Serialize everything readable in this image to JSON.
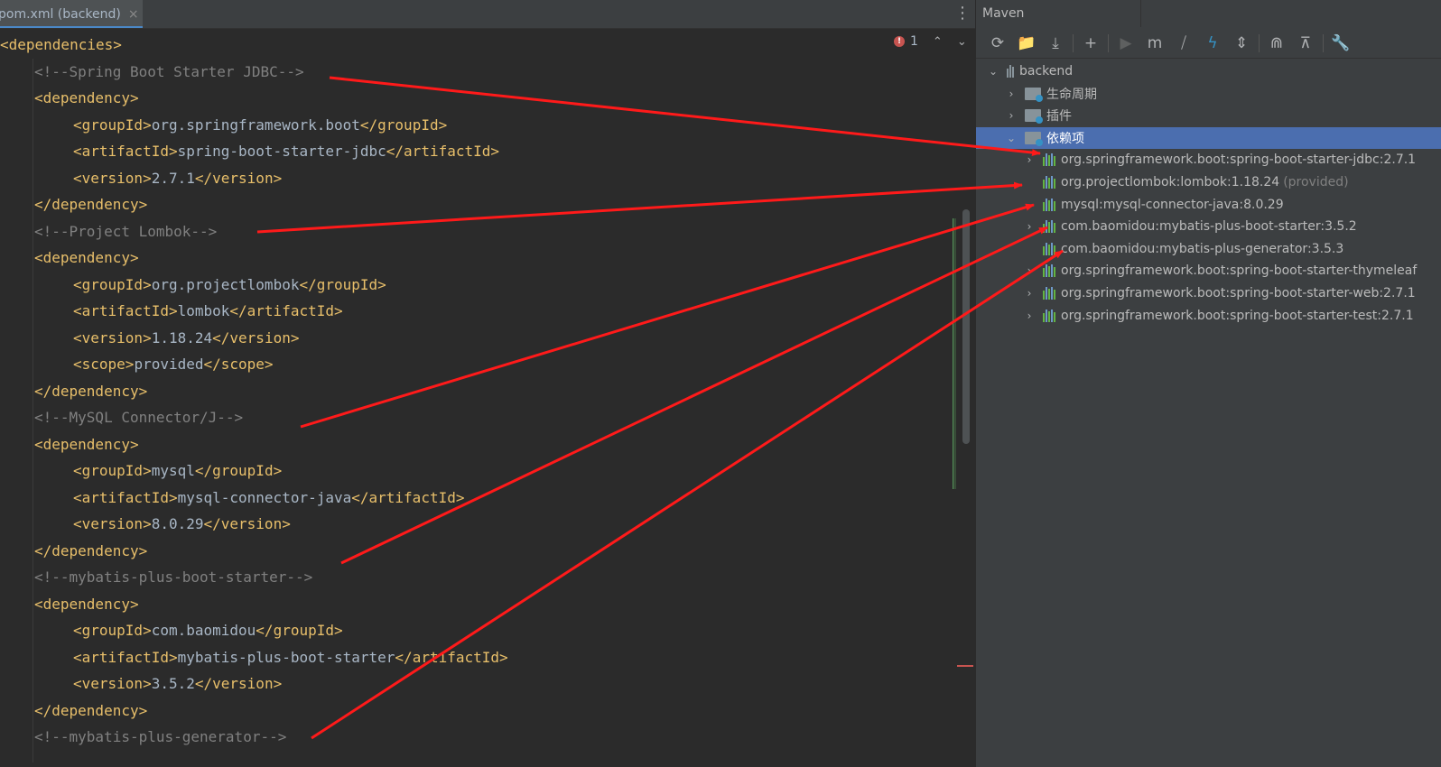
{
  "editor": {
    "tab_label": "pom.xml (backend)",
    "tab_close": "×",
    "more_icon": "⋮",
    "inspection": {
      "error_count": "1",
      "error_icon": "!",
      "up": "⌃",
      "down": "⌄"
    },
    "lines": [
      {
        "indent": 0,
        "parts": [
          [
            "tag",
            "<dependencies>"
          ]
        ]
      },
      {
        "indent": 1,
        "parts": [
          [
            "cmt",
            "<!--Spring Boot Starter JDBC-->"
          ]
        ]
      },
      {
        "indent": 1,
        "parts": [
          [
            "tag",
            "<dependency>"
          ]
        ]
      },
      {
        "indent": 2,
        "parts": [
          [
            "tag",
            "<groupId>"
          ],
          [
            "txt",
            "org.springframework.boot"
          ],
          [
            "tag",
            "</groupId>"
          ]
        ]
      },
      {
        "indent": 2,
        "parts": [
          [
            "tag",
            "<artifactId>"
          ],
          [
            "txt",
            "spring-boot-starter-jdbc"
          ],
          [
            "tag",
            "</artifactId>"
          ]
        ]
      },
      {
        "indent": 2,
        "parts": [
          [
            "tag",
            "<version>"
          ],
          [
            "txt",
            "2.7.1"
          ],
          [
            "tag",
            "</version>"
          ]
        ]
      },
      {
        "indent": 1,
        "parts": [
          [
            "tag",
            "</dependency>"
          ]
        ]
      },
      {
        "indent": 1,
        "parts": [
          [
            "cmt",
            "<!--Project Lombok-->"
          ]
        ]
      },
      {
        "indent": 1,
        "parts": [
          [
            "tag",
            "<dependency>"
          ]
        ]
      },
      {
        "indent": 2,
        "parts": [
          [
            "tag",
            "<groupId>"
          ],
          [
            "txt",
            "org.projectlombok"
          ],
          [
            "tag",
            "</groupId>"
          ]
        ]
      },
      {
        "indent": 2,
        "parts": [
          [
            "tag",
            "<artifactId>"
          ],
          [
            "txt",
            "lombok"
          ],
          [
            "tag",
            "</artifactId>"
          ]
        ]
      },
      {
        "indent": 2,
        "parts": [
          [
            "tag",
            "<version>"
          ],
          [
            "txt",
            "1.18.24"
          ],
          [
            "tag",
            "</version>"
          ]
        ]
      },
      {
        "indent": 2,
        "parts": [
          [
            "tag",
            "<scope>"
          ],
          [
            "txt",
            "provided"
          ],
          [
            "tag",
            "</scope>"
          ]
        ]
      },
      {
        "indent": 1,
        "parts": [
          [
            "tag",
            "</dependency>"
          ]
        ]
      },
      {
        "indent": 1,
        "parts": [
          [
            "cmt",
            "<!--MySQL Connector/J-->"
          ]
        ]
      },
      {
        "indent": 1,
        "parts": [
          [
            "tag",
            "<dependency>"
          ]
        ]
      },
      {
        "indent": 2,
        "parts": [
          [
            "tag",
            "<groupId>"
          ],
          [
            "txt",
            "mysql"
          ],
          [
            "tag",
            "</groupId>"
          ]
        ]
      },
      {
        "indent": 2,
        "parts": [
          [
            "tag",
            "<artifactId>"
          ],
          [
            "txt",
            "mysql-connector-java"
          ],
          [
            "tag",
            "</artifactId>"
          ]
        ]
      },
      {
        "indent": 2,
        "parts": [
          [
            "tag",
            "<version>"
          ],
          [
            "txt",
            "8.0.29"
          ],
          [
            "tag",
            "</version>"
          ]
        ]
      },
      {
        "indent": 1,
        "parts": [
          [
            "tag",
            "</dependency>"
          ]
        ]
      },
      {
        "indent": 1,
        "parts": [
          [
            "cmt",
            "<!--mybatis-plus-boot-starter-->"
          ]
        ]
      },
      {
        "indent": 1,
        "parts": [
          [
            "tag",
            "<dependency>"
          ]
        ]
      },
      {
        "indent": 2,
        "parts": [
          [
            "tag",
            "<groupId>"
          ],
          [
            "txt",
            "com.baomidou"
          ],
          [
            "tag",
            "</groupId>"
          ]
        ]
      },
      {
        "indent": 2,
        "parts": [
          [
            "tag",
            "<artifactId>"
          ],
          [
            "txt",
            "mybatis-plus-boot-starter"
          ],
          [
            "tag",
            "</artifactId>"
          ]
        ]
      },
      {
        "indent": 2,
        "parts": [
          [
            "tag",
            "<version>"
          ],
          [
            "txt",
            "3.5.2"
          ],
          [
            "tag",
            "</version>"
          ]
        ]
      },
      {
        "indent": 1,
        "parts": [
          [
            "tag",
            "</dependency>"
          ]
        ]
      },
      {
        "indent": 1,
        "parts": [
          [
            "cmt",
            "<!--mybatis-plus-generator-->"
          ]
        ]
      }
    ]
  },
  "maven": {
    "title": "Maven",
    "toolbar": [
      {
        "name": "reload-icon",
        "glyph": "⟳"
      },
      {
        "name": "add-folder-icon",
        "glyph": "📁"
      },
      {
        "name": "download-icon",
        "glyph": "⤓"
      },
      {
        "sep": true
      },
      {
        "name": "plus-icon",
        "glyph": "+"
      },
      {
        "sep": true
      },
      {
        "name": "run-icon",
        "glyph": "▶",
        "dim": true
      },
      {
        "name": "maven-m-icon",
        "glyph": "m"
      },
      {
        "name": "toggle-offline-icon",
        "glyph": "⧸"
      },
      {
        "name": "skip-tests-icon",
        "glyph": "ϟ",
        "blue": true
      },
      {
        "name": "collapse-icon",
        "glyph": "⇕"
      },
      {
        "sep": true
      },
      {
        "name": "show-dependencies-icon",
        "glyph": "⋒"
      },
      {
        "name": "collapse-all-icon",
        "glyph": "⊼"
      },
      {
        "sep": true
      },
      {
        "name": "settings-wrench-icon",
        "glyph": "🔧"
      }
    ],
    "tree": [
      {
        "label": "backend",
        "chev": "⌄",
        "indent": 0,
        "icon": "module"
      },
      {
        "label": "生命周期",
        "chev": "›",
        "indent": 1,
        "icon": "folder"
      },
      {
        "label": "插件",
        "chev": "›",
        "indent": 1,
        "icon": "folder"
      },
      {
        "label": "依赖项",
        "chev": "⌄",
        "indent": 1,
        "icon": "folder",
        "selected": true
      },
      {
        "label": "org.springframework.boot:spring-boot-starter-jdbc:2.7.1",
        "chev": "›",
        "indent": 2,
        "icon": "lib"
      },
      {
        "label": "org.projectlombok:lombok:1.18.24",
        "extra": "(provided)",
        "chev": "",
        "indent": 2,
        "icon": "lib"
      },
      {
        "label": "mysql:mysql-connector-java:8.0.29",
        "chev": "",
        "indent": 2,
        "icon": "lib"
      },
      {
        "label": "com.baomidou:mybatis-plus-boot-starter:3.5.2",
        "chev": "›",
        "indent": 2,
        "icon": "lib"
      },
      {
        "label": "com.baomidou:mybatis-plus-generator:3.5.3",
        "chev": "",
        "indent": 2,
        "icon": "lib"
      },
      {
        "label": "org.springframework.boot:spring-boot-starter-thymeleaf",
        "chev": "›",
        "indent": 2,
        "icon": "lib"
      },
      {
        "label": "org.springframework.boot:spring-boot-starter-web:2.7.1",
        "chev": "›",
        "indent": 2,
        "icon": "lib"
      },
      {
        "label": "org.springframework.boot:spring-boot-starter-test:2.7.1",
        "chev": "›",
        "indent": 2,
        "icon": "lib"
      }
    ]
  },
  "colors": {
    "arrow": "#ff1a1a",
    "selected": "#4b6eaf"
  }
}
